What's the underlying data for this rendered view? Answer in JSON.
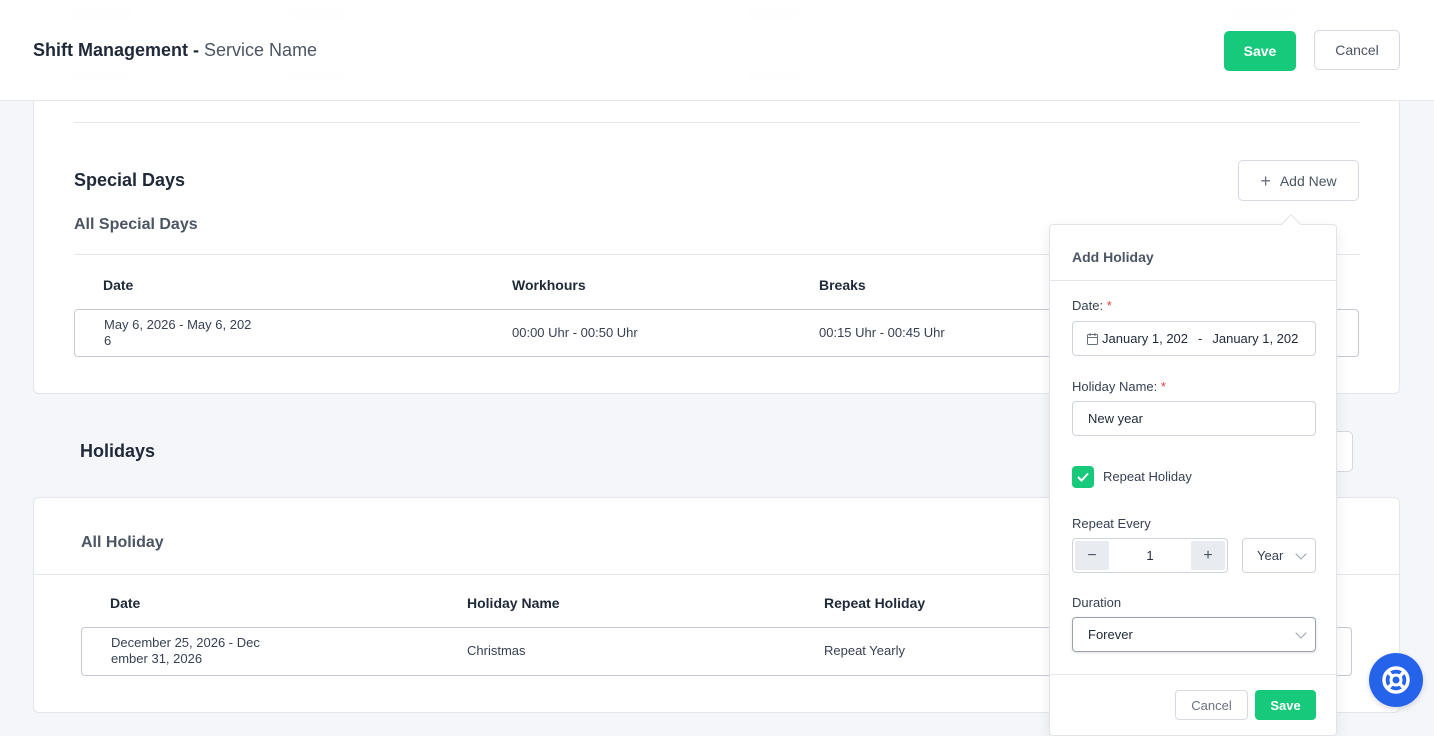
{
  "header": {
    "title": "Shift Management -",
    "service": "Service Name",
    "save_label": "Save",
    "cancel_label": "Cancel"
  },
  "special_days": {
    "title": "Special Days",
    "add_new_label": "Add New",
    "subtitle": "All Special Days",
    "columns": [
      "Date",
      "Workhours",
      "Breaks"
    ],
    "rows": [
      {
        "date_line1": "May 6, 2026 - May 6, 202",
        "date_line2": "6",
        "workhours": "00:00 Uhr - 00:50 Uhr",
        "breaks": "00:15 Uhr - 00:45 Uhr"
      }
    ]
  },
  "holidays": {
    "title": "Holidays",
    "subtitle": "All Holiday",
    "columns": [
      "Date",
      "Holiday Name",
      "Repeat Holiday"
    ],
    "rows": [
      {
        "date_line1": "December 25, 2026 - Dec",
        "date_line2": "ember 31, 2026",
        "name": "Christmas",
        "repeat": "Repeat Yearly"
      }
    ]
  },
  "add_holiday": {
    "title": "Add Holiday",
    "date_label": "Date:",
    "date_start": "January 1, 202",
    "date_sep": "-",
    "date_end": "January 1, 202",
    "name_label": "Holiday Name:",
    "name_value": "New year",
    "repeat_checked": true,
    "repeat_label": "Repeat Holiday",
    "repeat_every_label": "Repeat Every",
    "repeat_every_value": "1",
    "repeat_unit": "Year",
    "duration_label": "Duration",
    "duration_value": "Forever",
    "cancel_label": "Cancel",
    "save_label": "Save",
    "required_mark": "*"
  },
  "icons": {
    "calendar": "calendar-icon",
    "plus": "plus-icon",
    "minus": "minus-icon",
    "check": "check-icon",
    "help": "lifebuoy-icon"
  },
  "colors": {
    "primary": "#17c97a",
    "help_fab": "#2563eb",
    "required": "#e53e3e"
  }
}
